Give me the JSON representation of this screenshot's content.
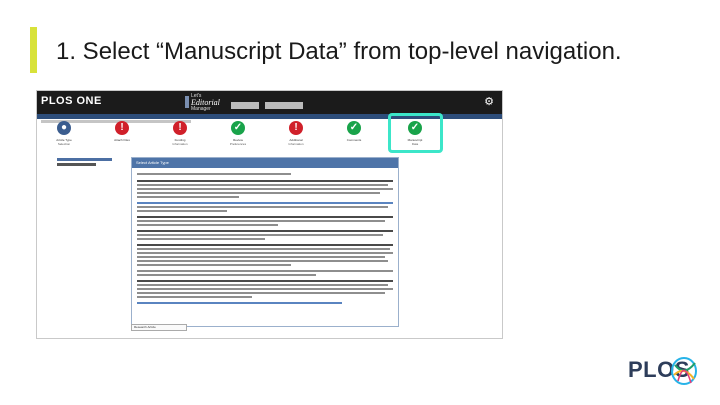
{
  "slide": {
    "title": "1. Select “Manuscript Data” from top-level navigation."
  },
  "app": {
    "brand": "PLOS ONE",
    "em_logo": {
      "line1": "Let's",
      "line2": "Editorial",
      "line3": "Manager"
    },
    "steps": [
      {
        "label": "Article Type",
        "sub": "Selection",
        "status": "current"
      },
      {
        "label": "Attach Files",
        "sub": "",
        "status": "error"
      },
      {
        "label": "Funding",
        "sub": "Information",
        "status": "complete"
      },
      {
        "label": "Review",
        "sub": "Preferences",
        "status": "error"
      },
      {
        "label": "Additional",
        "sub": "Information",
        "status": "error"
      },
      {
        "label": "Comments",
        "sub": "",
        "status": "complete"
      },
      {
        "label": "Manuscript",
        "sub": "Data",
        "status": "complete"
      }
    ],
    "panel_title": "Select Article Type",
    "select_value": "Research Article"
  },
  "colors": {
    "accent_bar": "#d8e23a",
    "highlight": "#3ce6c9",
    "topbar": "#1b1b1b",
    "panel_head": "#4e74a8"
  },
  "footer": {
    "logo_text": "PLOS"
  }
}
